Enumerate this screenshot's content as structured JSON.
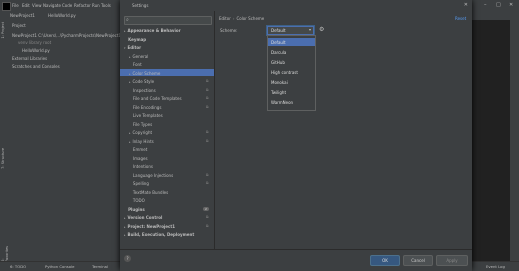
{
  "ide": {
    "menus": [
      "File",
      "Edit",
      "View",
      "Navigate",
      "Code",
      "Refactor",
      "Run",
      "Tools"
    ],
    "breadcrumb": [
      "NewProject1",
      "HelloWorld.py"
    ],
    "project_tree": {
      "header": "Project",
      "items": [
        {
          "label": "NewProject1  C:\\Users\\...\\PycharmProjects\\NewProject1"
        },
        {
          "label": "venv  library root"
        },
        {
          "label": "HelloWorld.py"
        },
        {
          "label": "External Libraries"
        },
        {
          "label": "Scratches and Consoles"
        }
      ]
    },
    "left_tabs": [
      "1: Project",
      "7: Structure",
      "2: Favorites"
    ],
    "status": {
      "todo": "6: TODO",
      "python_console": "Python Console",
      "terminal": "Terminal",
      "event_log": "Event Log"
    }
  },
  "dialog": {
    "title": "Settings",
    "search_icon": "search-icon",
    "tree": [
      {
        "label": "Appearance & Behavior",
        "bold": true,
        "arrow": "▸"
      },
      {
        "label": "Keymap",
        "bold": true,
        "arrow": ""
      },
      {
        "label": "Editor",
        "bold": true,
        "arrow": "▾"
      },
      {
        "label": "General",
        "bold": false,
        "arrow": "▸"
      },
      {
        "label": "Font",
        "bold": false,
        "arrow": ""
      },
      {
        "label": "Color Scheme",
        "bold": false,
        "arrow": "▸",
        "selected": true
      },
      {
        "label": "Code Style",
        "bold": false,
        "arrow": "▸",
        "config": true
      },
      {
        "label": "Inspections",
        "bold": false,
        "arrow": "",
        "config": true
      },
      {
        "label": "File and Code Templates",
        "bold": false,
        "arrow": "",
        "config": true
      },
      {
        "label": "File Encodings",
        "bold": false,
        "arrow": "",
        "config": true
      },
      {
        "label": "Live Templates",
        "bold": false,
        "arrow": ""
      },
      {
        "label": "File Types",
        "bold": false,
        "arrow": ""
      },
      {
        "label": "Copyright",
        "bold": false,
        "arrow": "▸",
        "config": true
      },
      {
        "label": "Inlay Hints",
        "bold": false,
        "arrow": "▸",
        "config": true
      },
      {
        "label": "Emmet",
        "bold": false,
        "arrow": ""
      },
      {
        "label": "Images",
        "bold": false,
        "arrow": ""
      },
      {
        "label": "Intentions",
        "bold": false,
        "arrow": ""
      },
      {
        "label": "Language Injections",
        "bold": false,
        "arrow": "",
        "config": true
      },
      {
        "label": "Spelling",
        "bold": false,
        "arrow": "",
        "config": true
      },
      {
        "label": "TextMate Bundles",
        "bold": false,
        "arrow": ""
      },
      {
        "label": "TODO",
        "bold": false,
        "arrow": ""
      },
      {
        "label": "Plugins",
        "bold": true,
        "arrow": "",
        "badge": "2"
      },
      {
        "label": "Version Control",
        "bold": true,
        "arrow": "▸",
        "config": true
      },
      {
        "label": "Project: NewProject1",
        "bold": true,
        "arrow": "▸",
        "config": true
      },
      {
        "label": "Build, Execution, Deployment",
        "bold": true,
        "arrow": "▸"
      }
    ],
    "breadcrumb": {
      "parent": "Editor",
      "separator": "›",
      "current": "Color Scheme"
    },
    "reset_label": "Reset",
    "scheme_label": "Scheme:",
    "scheme_value": "Default",
    "scheme_options": [
      "Default",
      "Darcula",
      "GitHub",
      "High contrast",
      "Monokai",
      "Twilight",
      "WarmNeon"
    ],
    "buttons": {
      "ok": "OK",
      "cancel": "Cancel",
      "apply": "Apply",
      "help": "?"
    }
  }
}
